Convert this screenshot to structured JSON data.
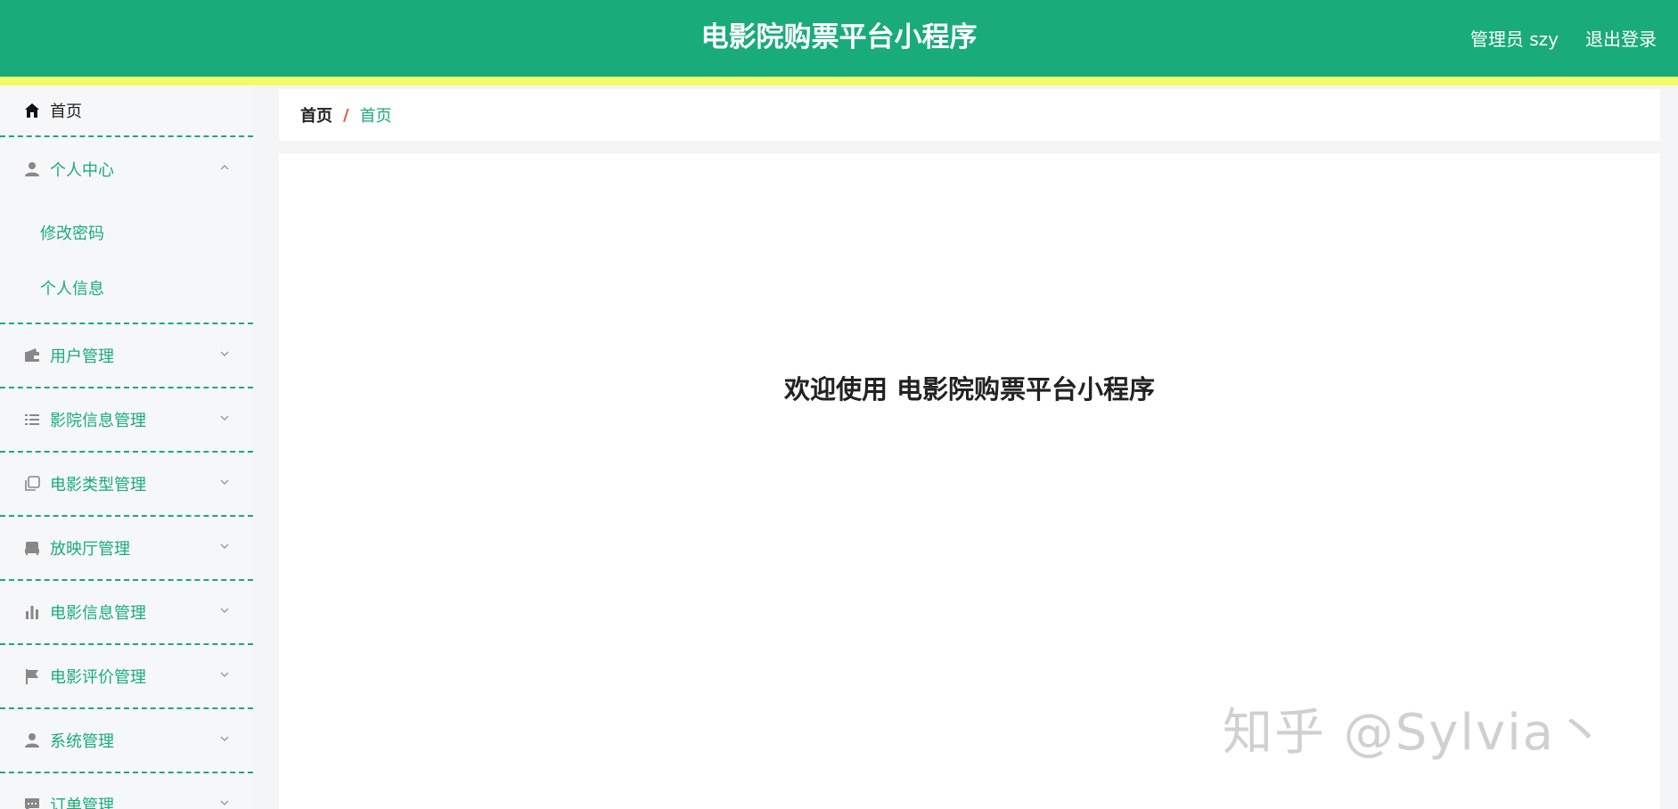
{
  "header": {
    "title": "电影院购票平台小程序",
    "user_label": "管理员 szy",
    "logout_label": "退出登录"
  },
  "sidebar": {
    "home": {
      "label": "首页",
      "icon": "home-icon"
    },
    "personal": {
      "label": "个人中心",
      "icon": "user-icon",
      "expanded": true,
      "children": [
        "修改密码",
        "个人信息"
      ]
    },
    "items": [
      {
        "label": "用户管理",
        "icon": "wallet-icon"
      },
      {
        "label": "影院信息管理",
        "icon": "list-icon"
      },
      {
        "label": "电影类型管理",
        "icon": "copy-icon"
      },
      {
        "label": "放映厅管理",
        "icon": "sofa-icon"
      },
      {
        "label": "电影信息管理",
        "icon": "bar-chart-icon"
      },
      {
        "label": "电影评价管理",
        "icon": "flag-icon"
      },
      {
        "label": "系统管理",
        "icon": "user-icon"
      },
      {
        "label": "订单管理",
        "icon": "message-icon"
      }
    ]
  },
  "breadcrumb": {
    "home": "首页",
    "separator": "/",
    "current": "首页"
  },
  "main": {
    "welcome": "欢迎使用 电影院购票平台小程序"
  },
  "watermark": "知乎 @Sylvia丶",
  "colors": {
    "primary": "#1aab7a",
    "stripe": "#f4fb69",
    "separator": "#e0522f"
  }
}
